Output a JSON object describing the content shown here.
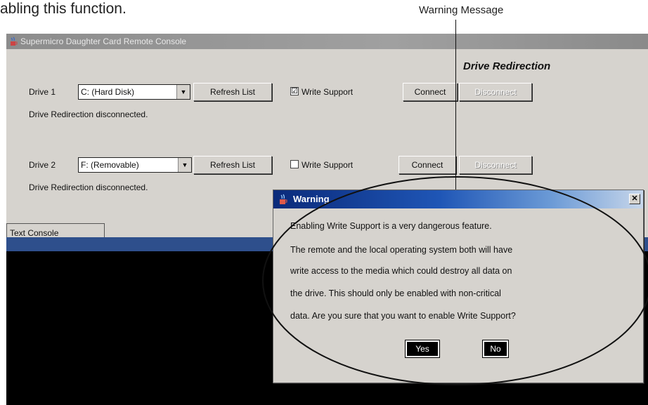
{
  "doc": {
    "top_text": "abling this function."
  },
  "callout": {
    "label": "Warning Message"
  },
  "window": {
    "title": "Supermicro Daughter Card Remote Console",
    "section_title": "Drive Redirection",
    "drive1": {
      "label": "Drive 1",
      "combo_value": "C: (Hard Disk)",
      "refresh_label": "Refresh List",
      "write_support_label": "Write Support",
      "write_support_checked": "☑",
      "connect_label": "Connect",
      "disconnect_label": "Disconnect",
      "status": "Drive Redirection disconnected."
    },
    "drive2": {
      "label": "Drive 2",
      "combo_value": "F: (Removable)",
      "refresh_label": "Refresh List",
      "write_support_label": "Write Support",
      "connect_label": "Connect",
      "disconnect_label": "Disconnect",
      "status": "Drive Redirection disconnected."
    },
    "tab_label": "Text Console"
  },
  "dialog": {
    "title": "Warning",
    "close_glyph": "✕",
    "message_lines": [
      "Enabling Write Support is a very dangerous feature.",
      "The remote and the local operating system both will have",
      "write access to the media which could destroy all data on",
      "the drive. This should only be enabled with non-critical",
      "data. Are you sure that you want to enable Write Support?"
    ],
    "yes_label": "Yes",
    "no_label": "No"
  },
  "colors": {
    "dialog_title_start": "#0a2a7a",
    "console_bar": "#2e4f8c",
    "window_bg": "#d6d3ce"
  }
}
